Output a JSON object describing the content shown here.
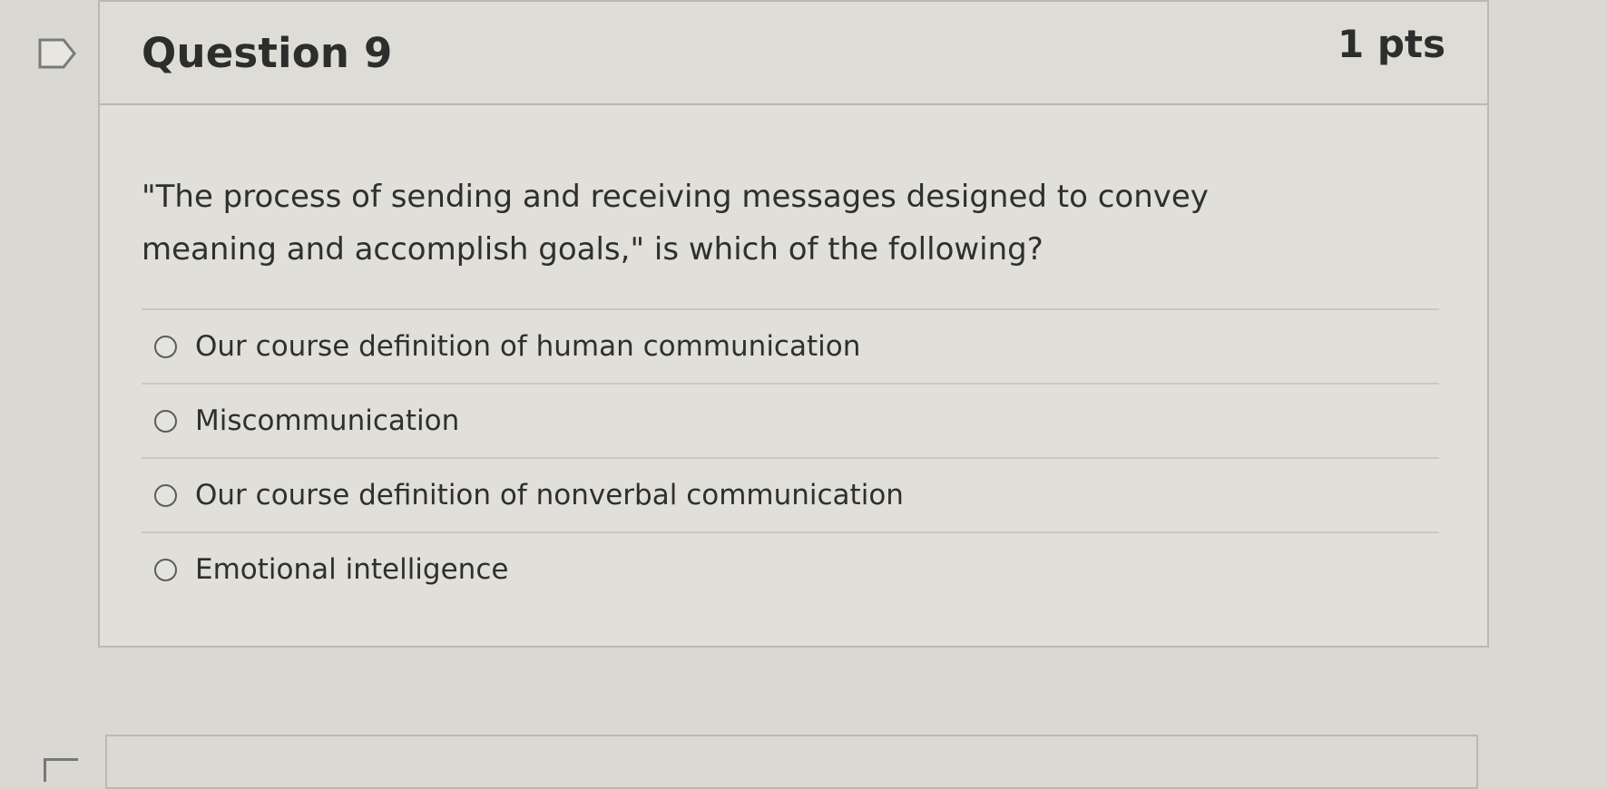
{
  "question": {
    "title": "Question 9",
    "points": "1 pts",
    "text": "\"The process of sending and receiving messages designed to convey meaning and accomplish goals,\" is which of the following?",
    "answers": [
      {
        "label": "Our course definition of human communication"
      },
      {
        "label": "Miscommunication"
      },
      {
        "label": "Our course definition of nonverbal communication"
      },
      {
        "label": "Emotional intelligence"
      }
    ]
  },
  "icons": {
    "flag": "flag-icon",
    "radio": "radio-button-icon"
  },
  "colors": {
    "background": "#d9d8d2",
    "card": "#e0dfd9",
    "border": "#b9b8b1",
    "text": "#2b2b2b"
  }
}
